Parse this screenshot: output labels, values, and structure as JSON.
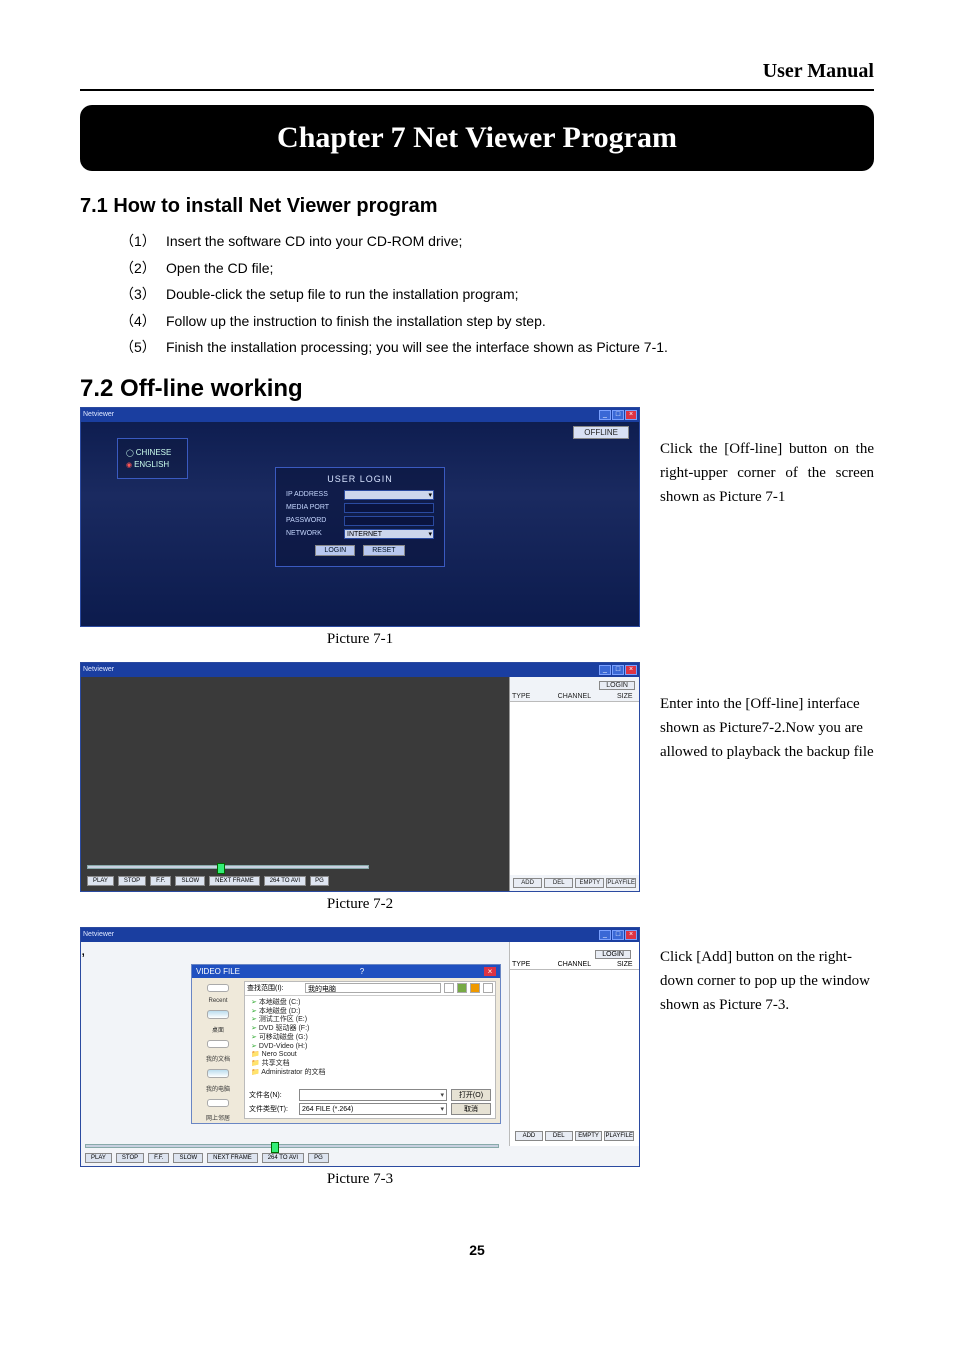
{
  "header": {
    "title": "User Manual"
  },
  "chapter": {
    "title": "Chapter 7 Net Viewer Program"
  },
  "section71": {
    "heading": "7.1 How to install Net Viewer program",
    "steps": [
      {
        "num": "（1）",
        "text": "Insert the software CD into your CD-ROM drive;"
      },
      {
        "num": "（2）",
        "text": "Open the CD file;"
      },
      {
        "num": "（3）",
        "text": "Double-click the setup file to run the installation program;"
      },
      {
        "num": "（4）",
        "text": "Follow up the instruction to finish the installation step by step."
      },
      {
        "num": "（5）",
        "text": "Finish the installation processing; you will see the interface shown as Picture 7-1."
      }
    ]
  },
  "section72": {
    "heading": "7.2 Off-line working"
  },
  "app": {
    "title": "Netviewer"
  },
  "window_buttons": {
    "min": "_",
    "max": "□",
    "close": "×"
  },
  "pic71": {
    "caption": "Picture 7-1",
    "lang": {
      "chinese": "CHINESE",
      "english": "ENGLISH"
    },
    "offline_btn": "OFFLINE",
    "login": {
      "title": "USER LOGIN",
      "ip": "IP ADDRESS",
      "media": "MEDIA PORT",
      "password": "PASSWORD",
      "network": "NETWORK",
      "network_value": "INTERNET",
      "login_btn": "LOGIN",
      "reset_btn": "RESET"
    },
    "desc": "Click the [Off-line] button on the right-upper corner of the screen shown as Picture 7-1"
  },
  "pic72": {
    "caption": "Picture 7-2",
    "login_btn": "LOGIN",
    "cols": {
      "type": "TYPE",
      "channel": "CHANNEL",
      "size": "SIZE"
    },
    "btns": {
      "add": "ADD",
      "del": "DEL",
      "empty": "EMPTY",
      "playfile": "PLAYFILE"
    },
    "playbar": {
      "play": "PLAY",
      "stop": "STOP",
      "ff": "F.F.",
      "slow": "SLOW",
      "next": "NEXT FRAME",
      "a264": "264 TO AVI",
      "pg": "PG"
    },
    "desc": "Enter into the [Off-line] interface shown as Picture7-2.Now you are allowed to playback the backup file"
  },
  "pic73": {
    "caption": "Picture 7-3",
    "dialog": {
      "title": "VIDEO FILE",
      "look_in_label": "查找范围(I):",
      "look_in_value": "我的电脑",
      "items": [
        "本地磁盘 (C:)",
        "本地磁盘 (D:)",
        "测试工作区 (E:)",
        "DVD 驱动器 (F:)",
        "可移动磁盘 (G:)",
        "DVD-Video (H:)",
        "Nero Scout",
        "共享文档",
        "Administrator 的文档"
      ],
      "sidebar": {
        "recent": "Recent",
        "desktop": "桌面",
        "mydoc": "我的文档",
        "mypc": "我的电脑",
        "net": "网上邻居"
      },
      "filename_label": "文件名(N):",
      "filetype_label": "文件类型(T):",
      "filetype_value": "264 FILE (*.264)",
      "open_btn": "打开(O)",
      "cancel_btn": "取消"
    },
    "right": {
      "login_btn": "LOGIN",
      "cols": {
        "type": "TYPE",
        "channel": "CHANNEL",
        "size": "SIZE"
      },
      "btns": {
        "add": "ADD",
        "del": "DEL",
        "empty": "EMPTY",
        "playfile": "PLAYFILE"
      }
    },
    "playbar": {
      "play": "PLAY",
      "stop": "STOP",
      "ff": "F.F.",
      "slow": "SLOW",
      "next": "NEXT FRAME",
      "a264": "264 TO AVI",
      "pg": "PG"
    },
    "desc": "Click [Add] button on the right-down corner to pop up the window shown as Picture 7-3."
  },
  "page_number": "25"
}
